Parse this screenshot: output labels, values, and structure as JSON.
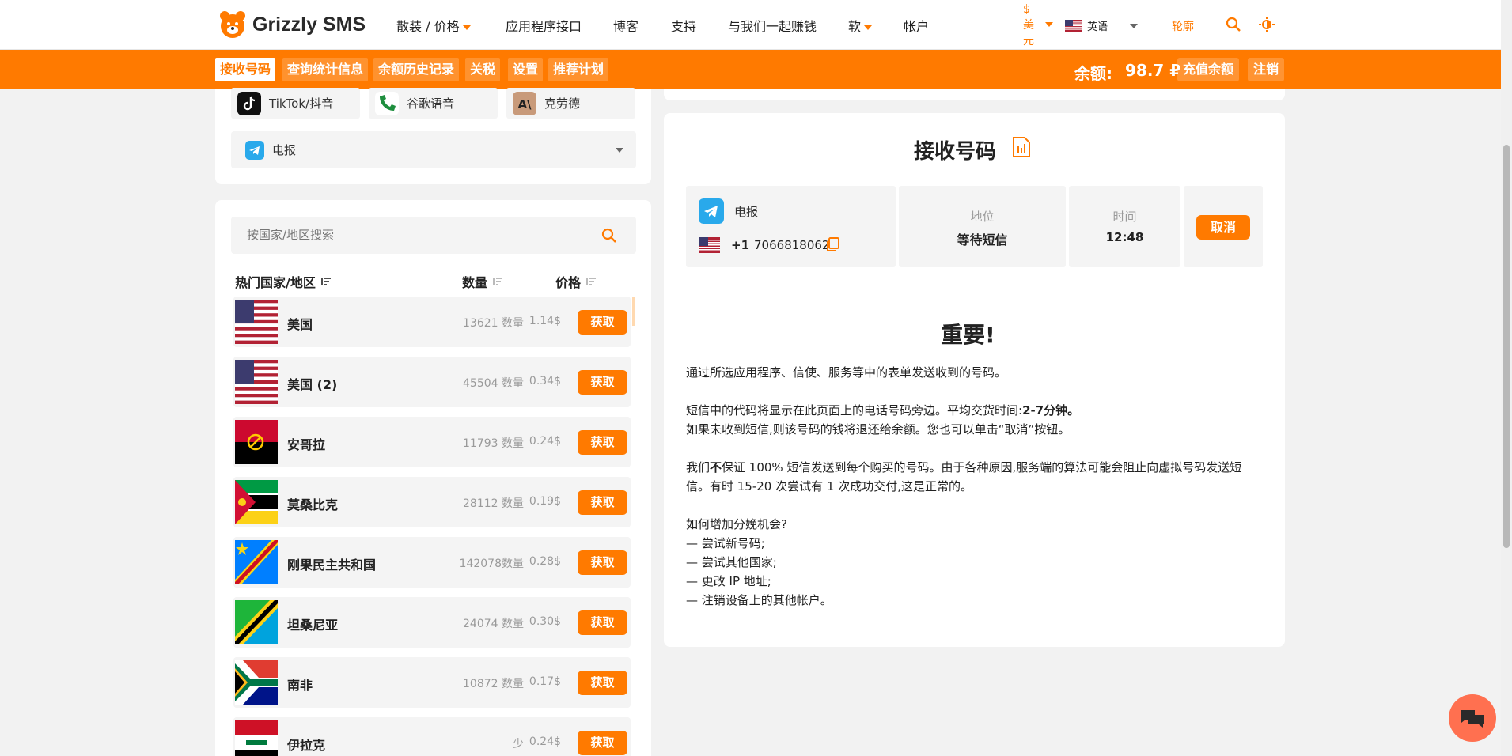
{
  "brand": {
    "name": "Grizzly SMS"
  },
  "nav": {
    "items": [
      {
        "label": "散装 / 价格",
        "dropdown": true
      },
      {
        "label": "应用程序接口",
        "dropdown": false
      },
      {
        "label": "博客",
        "dropdown": false
      },
      {
        "label": "支持",
        "dropdown": false
      },
      {
        "label": "与我们一起赚钱",
        "dropdown": false
      },
      {
        "label": "软",
        "dropdown": true
      },
      {
        "label": "帐户",
        "dropdown": false
      }
    ],
    "currency": "$ 美元",
    "language": "英语",
    "login": "轮廓"
  },
  "subnav": {
    "tabs": [
      "接收号码",
      "查询统计信息",
      "余额历史记录",
      "关税",
      "设置",
      "推荐计划"
    ],
    "active_tab": "接收号码",
    "balance_label": "余额:",
    "balance_value": "98.7 ₽",
    "topup_label": "充值余额",
    "logout_label": "注销"
  },
  "services": {
    "chips": [
      {
        "name": "TikTok/抖音",
        "icon": "tiktok-icon"
      },
      {
        "name": "谷歌语音",
        "icon": "google-voice-icon"
      },
      {
        "name": "克劳德",
        "icon": "claude-icon"
      }
    ],
    "selected": "电报",
    "selected_icon": "telegram-icon"
  },
  "countries": {
    "search_placeholder": "按国家/地区搜索",
    "headers": {
      "country": "热门国家/地区",
      "quantity": "数量",
      "price": "价格"
    },
    "get_label": "获取",
    "rows": [
      {
        "name": "美国",
        "qty": "13621 数量",
        "price": "1.14$",
        "flag": "us-flag"
      },
      {
        "name": "美国 (2)",
        "qty": "45504 数量",
        "price": "0.34$",
        "flag": "us-flag"
      },
      {
        "name": "安哥拉",
        "qty": "11793 数量",
        "price": "0.24$",
        "flag": "angola-flag"
      },
      {
        "name": "莫桑比克",
        "qty": "28112 数量",
        "price": "0.19$",
        "flag": "mozambique-flag"
      },
      {
        "name": "刚果民主共和国",
        "qty": "142078数量",
        "price": "0.28$",
        "flag": "drc-flag"
      },
      {
        "name": "坦桑尼亚",
        "qty": "24074 数量",
        "price": "0.30$",
        "flag": "tanzania-flag"
      },
      {
        "name": "南非",
        "qty": "10872 数量",
        "price": "0.17$",
        "flag": "south-africa-flag"
      },
      {
        "name": "伊拉克",
        "qty": "少",
        "price": "0.24$",
        "flag": "iraq-flag"
      }
    ]
  },
  "receive": {
    "title": "接收号码",
    "order": {
      "service": "电报",
      "phone_prefix": "+1",
      "phone_number": "7066818062",
      "status_label": "地位",
      "status_value": "等待短信",
      "time_label": "时间",
      "time_value": "12:48",
      "cancel_label": "取消"
    }
  },
  "important": {
    "title": "重要!",
    "p1": "通过所选应用程序、信使、服务等中的表单发送收到的号码。",
    "p2a": "短信中的代码将显示在此页面上的电话号码旁边。平均交货时间:",
    "p2b": "2-7分钟。",
    "p2c": "如果未收到短信,则该号码的钱将退还给余额。您也可以单击“取消”按钮。",
    "p3a": "我们",
    "p3b": "不",
    "p3c": "保证 100% 短信发送到每个购买的号码。由于各种原因,服务端的算法可能会阻止向虚拟号码发送短信。有时 15-20 次尝试有 1 次成功交付,这是正常的。",
    "tips_title": "如何增加分娩机会?",
    "tips": [
      "— 尝试新号码;",
      "— 尝试其他国家;",
      "— 更改 IP 地址;",
      "— 注销设备上的其他帐户。"
    ]
  },
  "colors": {
    "accent": "#ff7a00",
    "bg": "#f2f2f2",
    "chip": "#f4f4f4"
  }
}
